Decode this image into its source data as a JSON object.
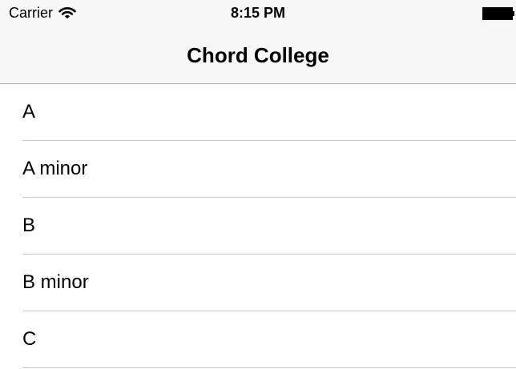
{
  "status_bar": {
    "carrier": "Carrier",
    "wifi_icon": "wifi-icon",
    "time": "8:15 PM",
    "battery_icon": "battery-icon"
  },
  "nav_bar": {
    "title": "Chord College"
  },
  "chords": [
    {
      "label": "A"
    },
    {
      "label": "A minor"
    },
    {
      "label": "B"
    },
    {
      "label": "B minor"
    },
    {
      "label": "C"
    }
  ],
  "colors": {
    "bar_background": "#f7f7f7",
    "bar_border": "#b2b2b2",
    "separator": "#c8c7cc",
    "text": "#000000"
  }
}
